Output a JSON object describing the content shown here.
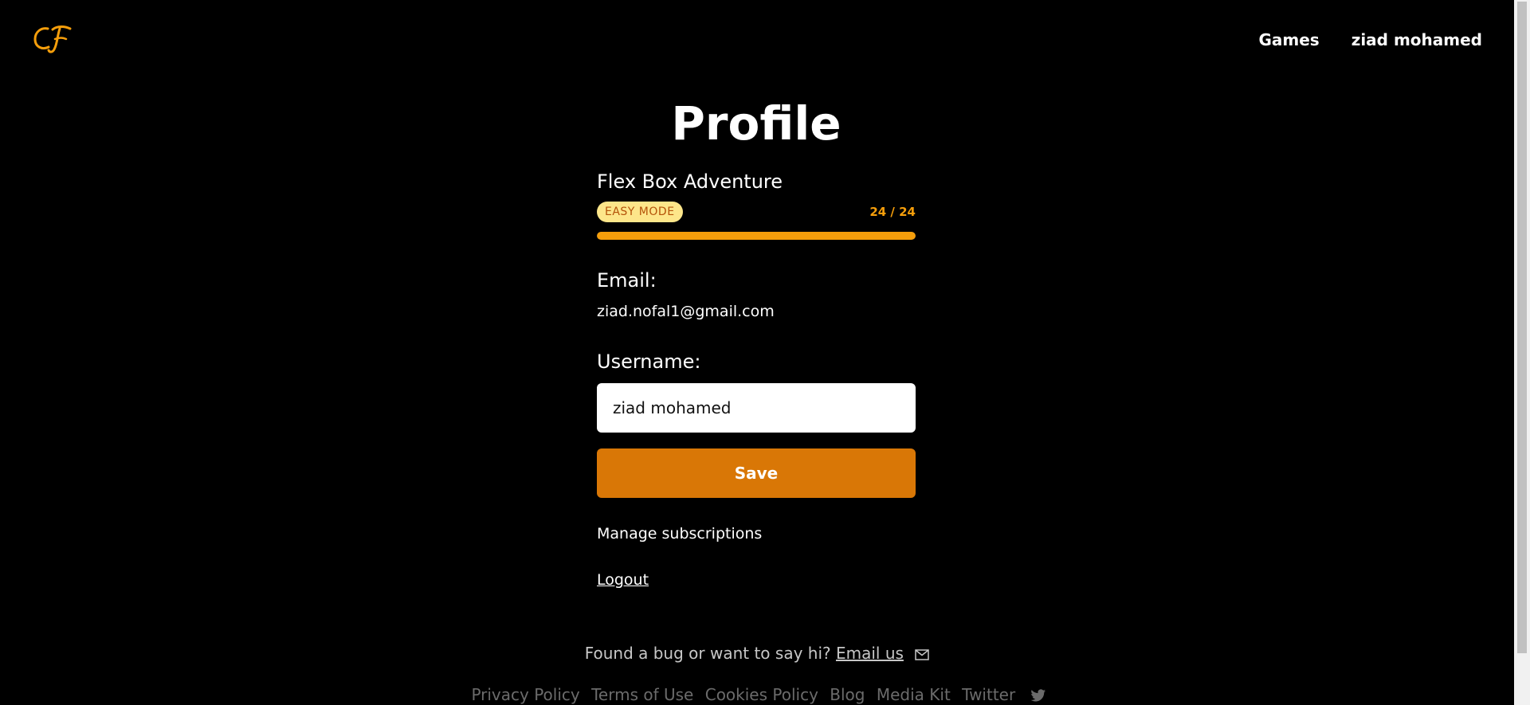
{
  "header": {
    "nav": {
      "games": "Games",
      "user": "ziad mohamed"
    }
  },
  "main": {
    "title": "Profile",
    "game": {
      "name": "Flex Box Adventure",
      "mode": "EASY MODE",
      "score": "24 / 24",
      "progress_percent": 100
    },
    "email": {
      "label": "Email:",
      "value": "ziad.nofal1@gmail.com"
    },
    "username": {
      "label": "Username:",
      "value": "ziad mohamed"
    },
    "save_label": "Save",
    "manage_label": "Manage subscriptions",
    "logout_label": "Logout"
  },
  "footer": {
    "message": "Found a bug or want to say hi?",
    "email_link": "Email us",
    "links": [
      "Privacy Policy",
      "Terms of Use",
      "Cookies Policy",
      "Blog",
      "Media Kit",
      "Twitter"
    ]
  },
  "colors": {
    "accent": "#d97706",
    "progress": "#f59e0b",
    "badge_bg": "#fde68a",
    "badge_text": "#b45309"
  },
  "icons": [
    "logo-icon",
    "mail-icon",
    "twitter-icon"
  ]
}
